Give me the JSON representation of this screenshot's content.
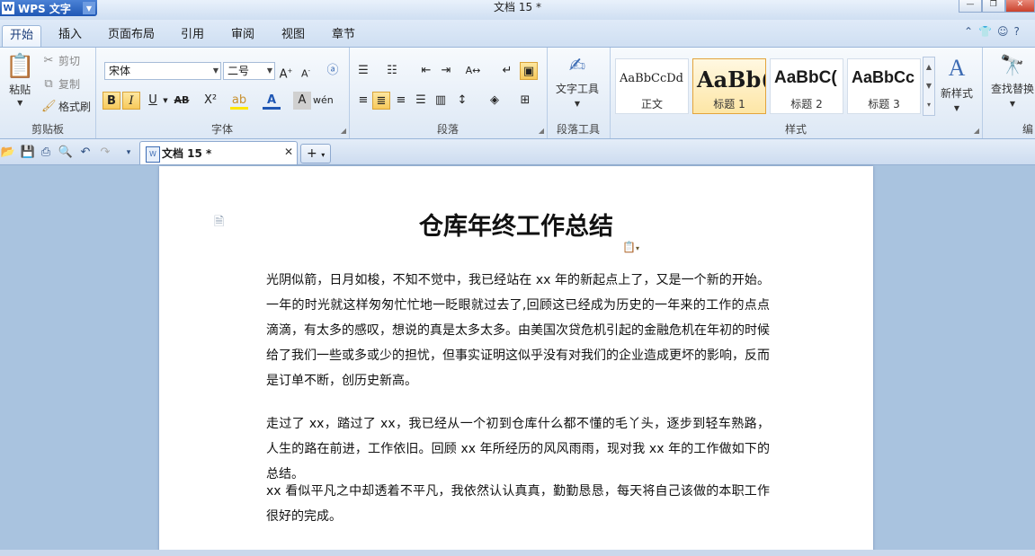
{
  "app": {
    "name": "WPS 文字",
    "logo_letter": "W",
    "window_title": "文档 15 *"
  },
  "menu": {
    "tabs": [
      "开始",
      "插入",
      "页面布局",
      "引用",
      "审阅",
      "视图",
      "章节"
    ],
    "active": 0
  },
  "ribbon": {
    "clipboard": {
      "paste": "粘贴",
      "cut": "剪切",
      "copy": "复制",
      "format_painter": "格式刷",
      "label": "剪贴板"
    },
    "font": {
      "family": "宋体",
      "size": "二号",
      "label": "字体"
    },
    "paragraph": {
      "label": "段落"
    },
    "text_tools": {
      "button": "文字工具",
      "label": "段落工具"
    },
    "styles": {
      "label": "样式",
      "items": [
        {
          "sample": "AaBbCcDd",
          "name": "正文"
        },
        {
          "sample": "AaBb(",
          "name": "标题 1"
        },
        {
          "sample": "AaBbC(",
          "name": "标题 2"
        },
        {
          "sample": "AaBbCc",
          "name": "标题 3"
        }
      ],
      "new_style": "新样式"
    },
    "find_replace": {
      "button": "查找替换",
      "label": "编"
    }
  },
  "doc_tab": {
    "name": "文档 15 *"
  },
  "document": {
    "title": "仓库年终工作总结",
    "paragraphs": [
      "光阴似箭，日月如梭，不知不觉中，我已经站在 xx 年的新起点上了，又是一个新的开始。一年的时光就这样匆匆忙忙地一眨眼就过去了,回顾这已经成为历史的一年来的工作的点点滴滴，有太多的感叹，想说的真是太多太多。由美国次贷危机引起的金融危机在年初的时候给了我们一些或多或少的担忧，但事实证明这似乎没有对我们的企业造成更坏的影响，反而是订单不断，创历史新高。",
      "走过了 xx，踏过了 xx，我已经从一个初到仓库什么都不懂的毛丫头，逐步到轻车熟路，人生的路在前进，工作依旧。回顾 xx 年所经历的风风雨雨，现对我 xx 年的工作做如下的总结。",
      "xx 看似平凡之中却透着不平凡，我依然认认真真，勤勤恳恳，每天将自己该做的本职工作很好的完成。"
    ]
  },
  "colors": {
    "ribbon_bg": "#dde8f5",
    "accent": "#1f57b4",
    "highlight": "#f7c95a"
  }
}
